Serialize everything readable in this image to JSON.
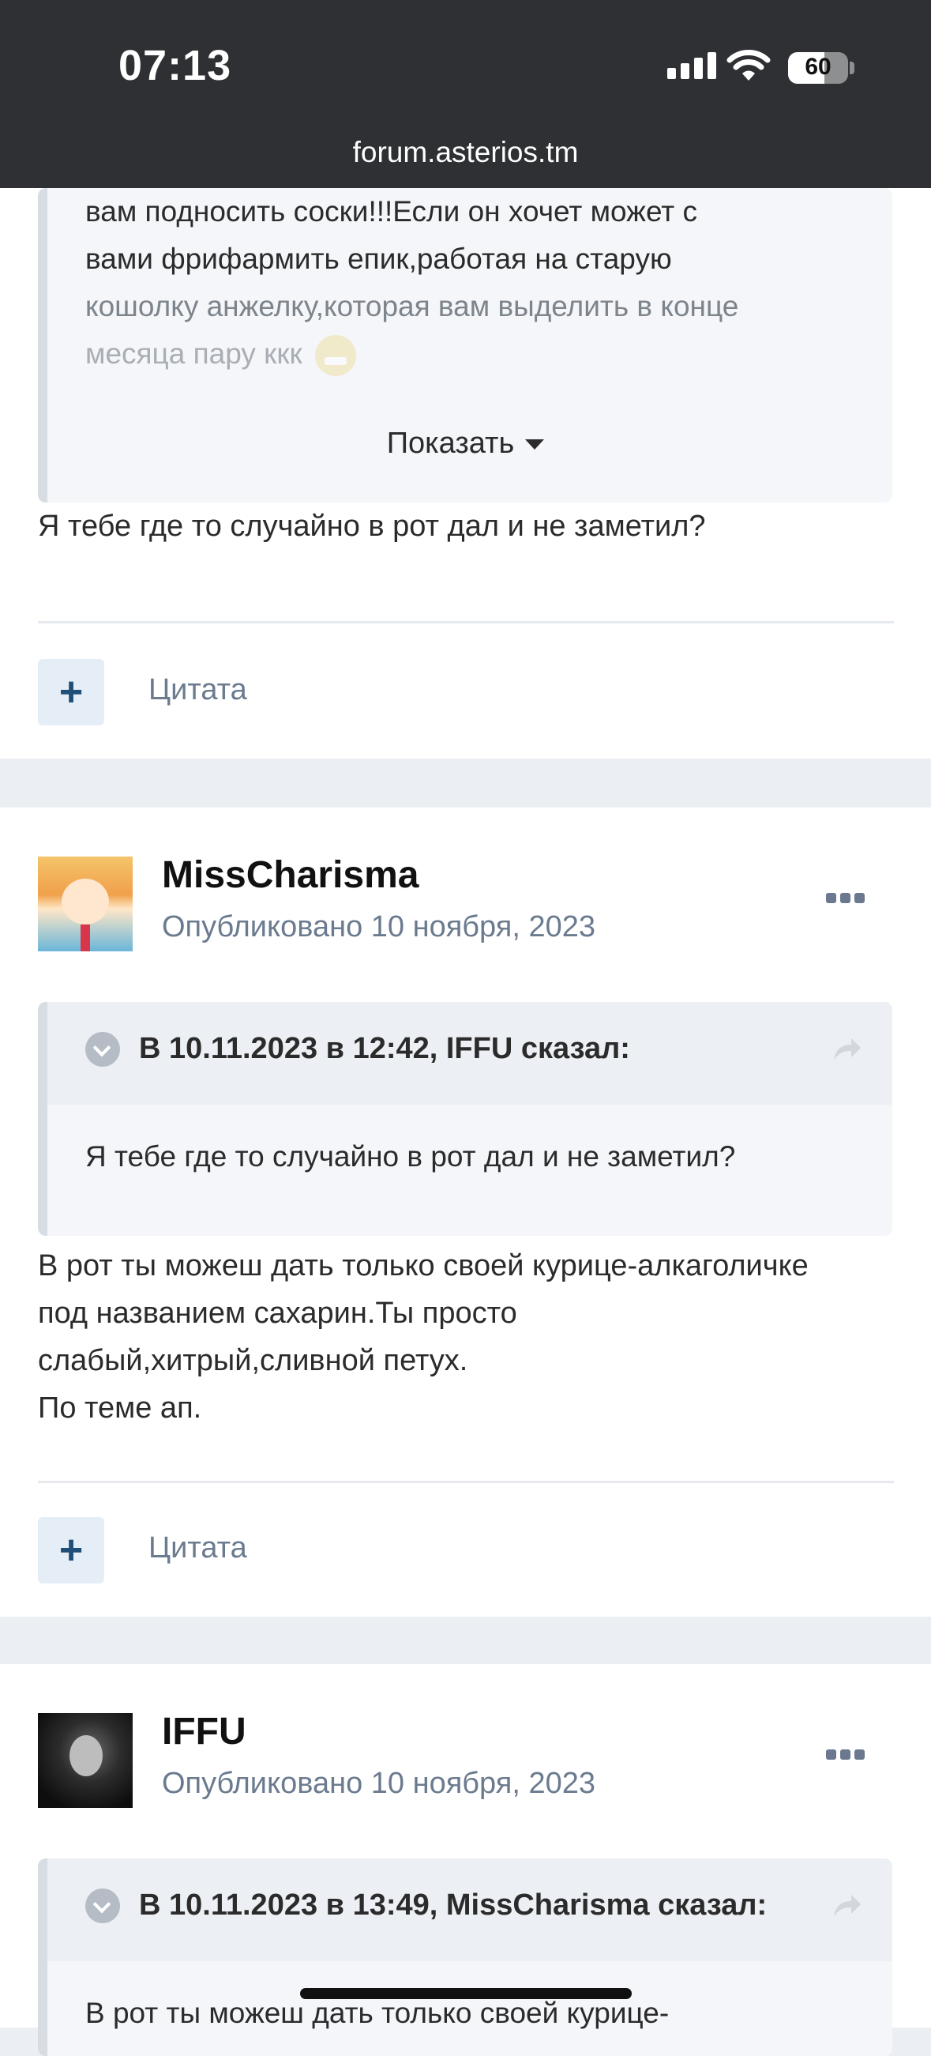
{
  "status": {
    "time": "07:13",
    "battery": "60",
    "url": "forum.asterios.tm"
  },
  "post1": {
    "quote_lines": [
      "вам подносить соски!!!Если он хочет может с",
      "вами фрифармить епик,работая на старую",
      "кошолку анжелку,которая вам выделить в конце",
      "месяца пару ккк"
    ],
    "show_label": "Показать",
    "body_text": "Я тебе где то случайно в рот дал и не заметил?",
    "plus": "+",
    "quote_button": "Цитата"
  },
  "post2": {
    "username": "MissCharisma",
    "date": "Опубликовано 10 ноября, 2023",
    "quote_header": "В 10.11.2023 в 12:42, IFFU сказал:",
    "quote_body": "Я тебе где то случайно в рот дал и не заметил?",
    "body_lines": [
      "В рот ты можеш дать только своей курице-алкаголичке",
      "под названием сахарин.Ты просто",
      "слабый,хитрый,сливной петух.",
      "По теме ап."
    ],
    "plus": "+",
    "quote_button": "Цитата"
  },
  "post3": {
    "username": "IFFU",
    "date": "Опубликовано 10 ноября, 2023",
    "quote_header": "В 10.11.2023 в 13:49, MissCharisma сказал:",
    "quote_body_partial": "В рот ты можеш дать только своей курице-"
  },
  "colors": {
    "status_bar": "#2e3033",
    "accent": "#1f4e79",
    "muted": "#6b7b8f",
    "quote_bg": "#f4f6f9"
  }
}
